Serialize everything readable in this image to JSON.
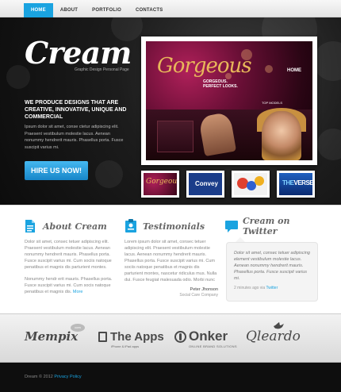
{
  "nav": {
    "items": [
      {
        "label": "HOME",
        "active": true
      },
      {
        "label": "ABOUT",
        "active": false
      },
      {
        "label": "PORTFOLIO",
        "active": false
      },
      {
        "label": "CONTACTS",
        "active": false
      }
    ]
  },
  "hero": {
    "logo": "Cream",
    "tagline": "Graphic Design Personal Page",
    "heading": "WE PRODUCE DESIGNS THAT ARE CREATIVE, INNOVATIVE, UNIQUE AND COMMERCIAL",
    "text": "Ipsum dolor sit amet, conse ctetur adipiscing elit. Praesent vestibulum molestie lacus. Aenean nonummy hendrerit mauris. Phasellus porta. Fusce suscipit varius mi.",
    "button_label": "HIRE US NOW!"
  },
  "slider": {
    "title": "Gorgeous",
    "subtitle_line1": "GORGEOUS.",
    "subtitle_line2": "PERFECT LOOKS.",
    "menu": "HOME",
    "menu2": "TOP MODELS",
    "thumbnails": [
      {
        "label": "Gorgeous"
      },
      {
        "label": "Convey"
      },
      {
        "label": ""
      },
      {
        "label_a": "THE",
        "label_b": "VERSE"
      }
    ]
  },
  "about": {
    "title": "About Cream",
    "text1": "Dolor sit amet, consec tetuer adipiscing elit. Praesent vestibulum molestie lacus. Aenean nonummy hendrerit mauris. Phasellus porta. Fusce suscipit varius mi. Cum sociis natoque penatibus et magnis dis parturient montes.",
    "text2": "Nonummy hendr erit mauris. Phasellus porta. Fusce suscipit varius mi. Cum socis natoque penatibus et magnis dis.",
    "more": "More"
  },
  "testimonials": {
    "title": "Testimonials",
    "text": "Lorem ipsum dolor sit amet, consec tetuer adipiscing elit. Praesent vestibulum molestie lacus. Aenean nonummy hendrerit mauris. Phasellus porta. Fusce suscipit varius mi. Cum sociis natoque penatibus et magnis dis parturient montes, nascetur ridiculus mus. Nulla dui. Fusce feugiat malesuada odio. Morbi nunc odio, gravida at, cursus nec, luctus a, lorem. Maecenas tristique orci ac sem. Duis ultricies pharetra magna. Donec accumsan malesuada orci. Donec sit amet eros.",
    "name": "Peter Jhonson",
    "role": "Social Care Company"
  },
  "twitter": {
    "title": "Cream on Twitter",
    "tweet": "Dolor sit amet, consec tetuer adipiscing element vestibulum molestie lacus. Aenean nonummy hendrerit mauris. Phasellus porta. Fusce suscipit varius mi.",
    "time": "2 minutes ago via",
    "via": "Twitter"
  },
  "clients": {
    "mempix": "Mempix",
    "mempix_badge": "com",
    "theapps": "The Apps",
    "theapps_sub": "iPhone & iPad apps",
    "onker": "Onker",
    "onker_sub": "ONLINE BRAND SOLUTIONS",
    "qleardo": "Qleardo"
  },
  "footer": {
    "text": "Dream © 2012",
    "link": "Privacy Policy"
  },
  "colors": {
    "accent": "#1aa3e0",
    "hero_bg": "#151515",
    "footer_bg": "#0e0e0e"
  }
}
